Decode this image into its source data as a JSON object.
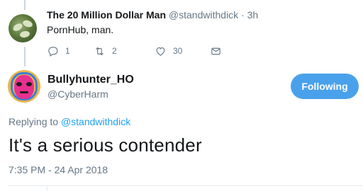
{
  "parent_tweet": {
    "name": "The 20 Million Dollar Man",
    "handle": "@standwithdick",
    "separator": "·",
    "time": "3h",
    "text": "PornHub, man.",
    "actions": {
      "reply_count": "1",
      "retweet_count": "2",
      "like_count": "30"
    }
  },
  "main_tweet": {
    "name": "Bullyhunter_HO",
    "handle": "@CyberHarm",
    "follow_label": "Following",
    "replying_prefix": "Replying to",
    "replying_handle": "@standwithdick",
    "text": "It's a serious contender",
    "timestamp": "7:35 PM - 24 Apr 2018"
  },
  "colors": {
    "accent": "#1da1f2",
    "button": "#4aa1eb",
    "muted": "#657786",
    "thread_line": "#ccd6dd"
  }
}
